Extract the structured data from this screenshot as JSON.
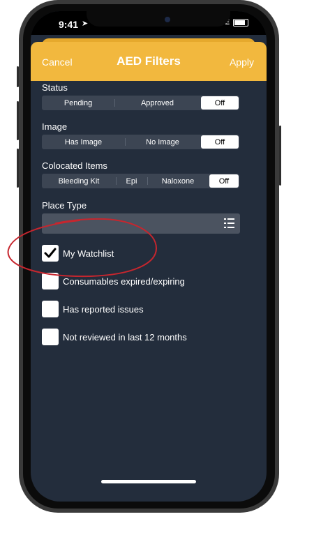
{
  "status_bar": {
    "time": "9:41",
    "network": "LTE"
  },
  "header": {
    "cancel": "Cancel",
    "title": "AED Filters",
    "apply": "Apply"
  },
  "status": {
    "label": "Status",
    "options": [
      "Pending",
      "Approved",
      "Off"
    ],
    "selected": "Off"
  },
  "image": {
    "label": "Image",
    "options": [
      "Has Image",
      "No Image",
      "Off"
    ],
    "selected": "Off"
  },
  "colocated": {
    "label": "Colocated Items",
    "options": [
      "Bleeding Kit",
      "Epi",
      "Naloxone",
      "Off"
    ],
    "selected": "Off"
  },
  "place_type": {
    "label": "Place Type",
    "value": ""
  },
  "checkboxes": [
    {
      "label": "My Watchlist",
      "checked": true
    },
    {
      "label": "Consumables expired/expiring",
      "checked": false
    },
    {
      "label": "Has reported issues",
      "checked": false
    },
    {
      "label": "Not reviewed in last 12 months",
      "checked": false
    }
  ],
  "colors": {
    "header": "#f2b83e",
    "background": "#232d3c",
    "annotation": "#c6262e"
  }
}
